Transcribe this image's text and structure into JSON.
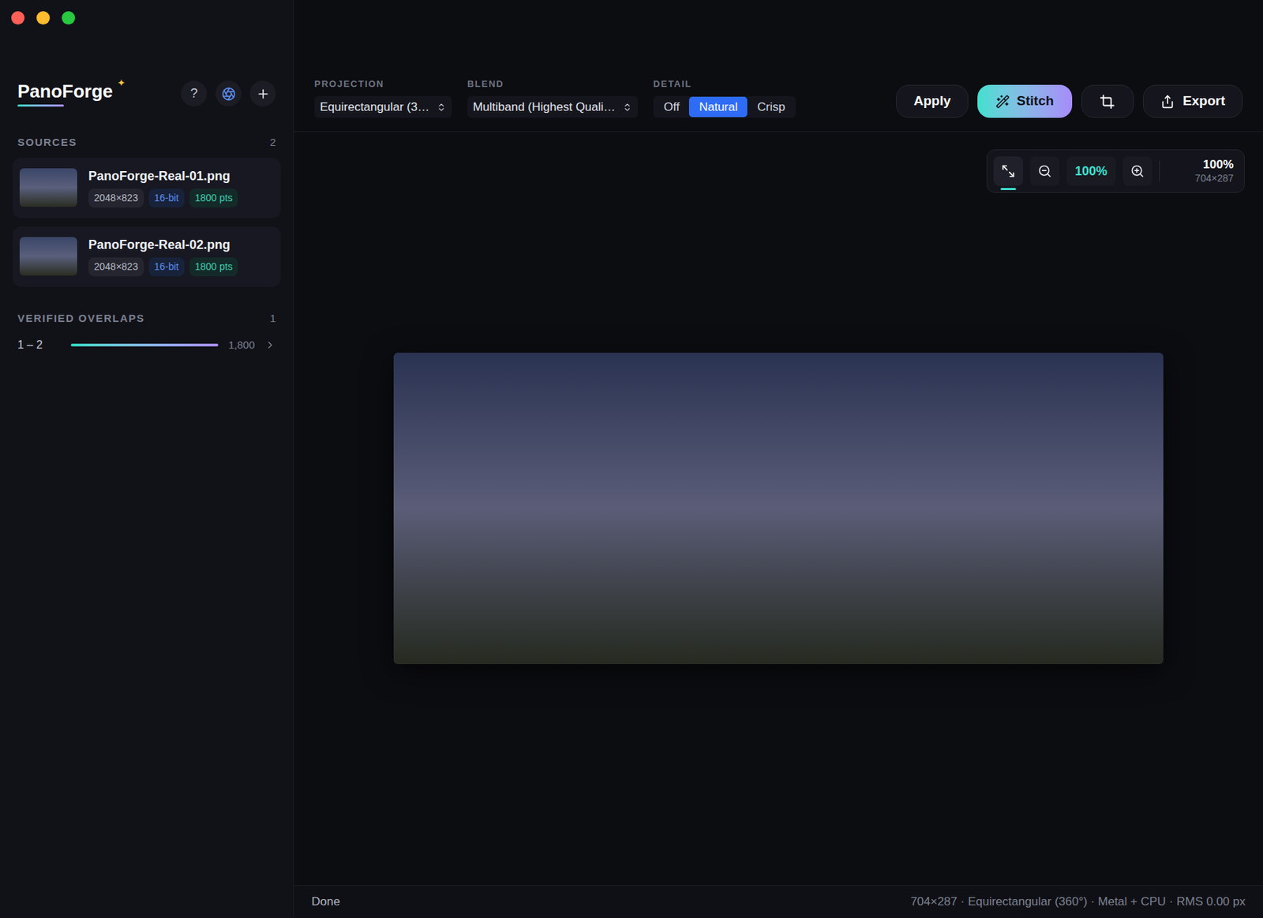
{
  "window": {
    "controls": [
      {
        "name": "close",
        "color": "#ff5f57"
      },
      {
        "name": "minimize",
        "color": "#febc2e"
      },
      {
        "name": "zoom",
        "color": "#28c840"
      }
    ]
  },
  "app": {
    "name": "PanoForge",
    "badge": "✦",
    "help": "?"
  },
  "sources": {
    "title": "SOURCES",
    "count": "2",
    "items": [
      {
        "name": "PanoForge-Real-01.png",
        "size": "2048×823",
        "depth": "16-bit",
        "points": "1800 pts"
      },
      {
        "name": "PanoForge-Real-02.png",
        "size": "2048×823",
        "depth": "16-bit",
        "points": "1800 pts"
      }
    ]
  },
  "overlaps": {
    "title": "VERIFIED OVERLAPS",
    "count": "1",
    "items": [
      {
        "pair": "1 – 2",
        "level": 1,
        "points": "1,800"
      }
    ]
  },
  "toolbar": {
    "projection": {
      "label": "PROJECTION",
      "value": "Equirectangular (3…"
    },
    "blend": {
      "label": "BLEND",
      "value": "Multiband (Highest Quali…"
    },
    "detail": {
      "label": "DETAIL",
      "options": [
        {
          "label": "Off",
          "selected": false
        },
        {
          "label": "Natural",
          "selected": true
        },
        {
          "label": "Crisp",
          "selected": false
        }
      ]
    },
    "apply": "Apply",
    "stitch": "Stitch",
    "export": "Export"
  },
  "zoom": {
    "fit_selected": true,
    "value": "100%",
    "readout": "100%",
    "dimensions": "704×287"
  },
  "status_bar": {
    "left": "Done",
    "right": "704×287 · Equirectangular (360°) · Metal + CPU · RMS 0.00 px"
  }
}
